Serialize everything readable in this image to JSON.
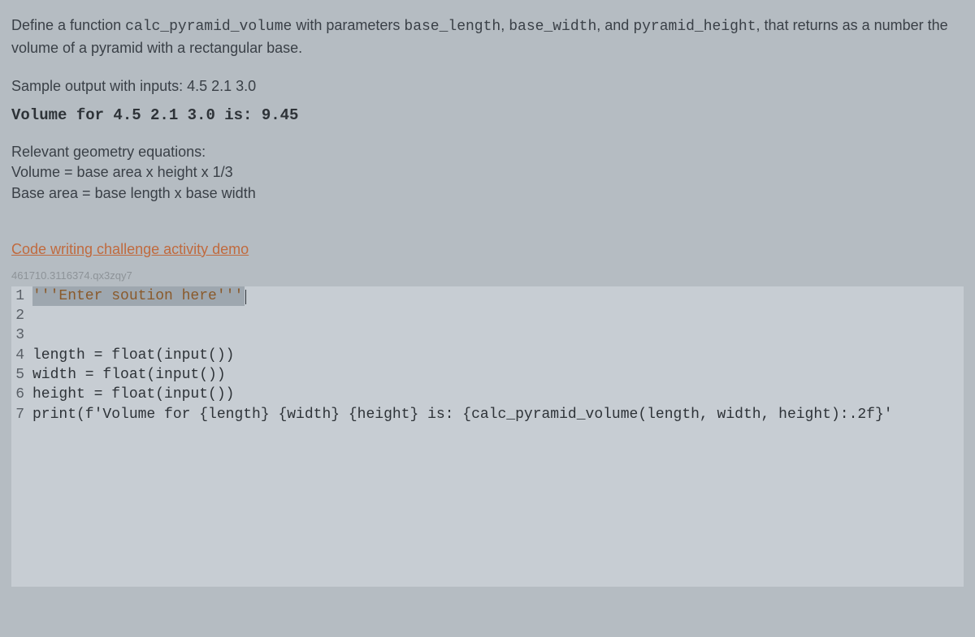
{
  "description": {
    "prefix": "Define a function ",
    "fn_name": "calc_pyramid_volume",
    "mid1": " with parameters ",
    "p1": "base_length",
    "sep1": ", ",
    "p2": "base_width",
    "sep2": ", and ",
    "p3": "pyramid_height",
    "suffix": ", that returns as a number the volume of a pyramid with a rectangular base."
  },
  "sample_label": "Sample output with inputs: 4.5 2.1 3.0",
  "sample_output": "Volume for 4.5 2.1 3.0 is: 9.45",
  "geometry": {
    "heading": "Relevant geometry equations:",
    "eq1": "Volume = base area x height x 1/3",
    "eq2": "Base area = base length x base width"
  },
  "demo_link": "Code writing challenge activity demo",
  "qid": "461710.3116374.qx3zqy7",
  "code": {
    "lines": [
      {
        "n": "1",
        "content": "'''Enter soution here'''",
        "highlight": true
      },
      {
        "n": "2",
        "content": ""
      },
      {
        "n": "3",
        "content": ""
      },
      {
        "n": "4",
        "content": "length = float(input())"
      },
      {
        "n": "5",
        "content": "width = float(input())"
      },
      {
        "n": "6",
        "content": "height = float(input())"
      },
      {
        "n": "7",
        "content": "print(f'Volume for {length} {width} {height} is: {calc_pyramid_volume(length, width, height):.2f}'"
      }
    ]
  }
}
